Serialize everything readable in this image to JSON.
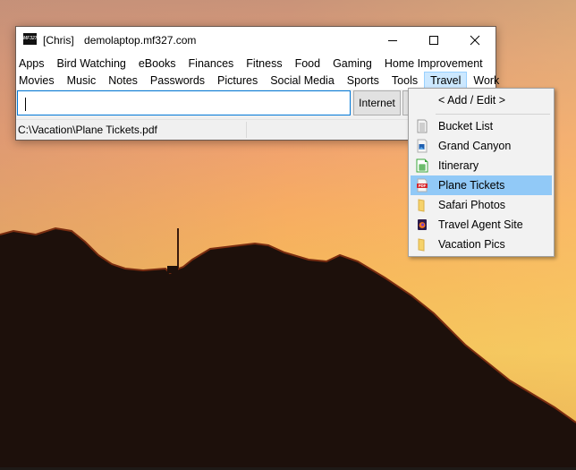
{
  "window": {
    "user": "[Chris]",
    "title": "demolaptop.mf327.com",
    "logo_text": "MF327",
    "controls": {
      "minimize": "minimize-icon",
      "maximize": "maximize-icon",
      "close": "close-icon"
    }
  },
  "menubar": {
    "row1": [
      "Apps",
      "Bird Watching",
      "eBooks",
      "Finances",
      "Fitness",
      "Food",
      "Gaming",
      "Home Improvement"
    ],
    "row2": [
      "Movies",
      "Music",
      "Notes",
      "Passwords",
      "Pictures",
      "Social Media",
      "Sports",
      "Tools",
      "Travel",
      "Work"
    ],
    "active": "Travel"
  },
  "search": {
    "value": "",
    "internet_button": "Internet"
  },
  "status": {
    "path": "C:\\Vacation\\Plane Tickets.pdf"
  },
  "dropdown": {
    "header": "< Add / Edit >",
    "items": [
      {
        "label": "Bucket List",
        "icon": "text-document-icon"
      },
      {
        "label": "Grand Canyon",
        "icon": "image-file-icon"
      },
      {
        "label": "Itinerary",
        "icon": "spreadsheet-icon"
      },
      {
        "label": "Plane Tickets",
        "icon": "pdf-icon",
        "highlighted": true
      },
      {
        "label": "Safari Photos",
        "icon": "folder-icon"
      },
      {
        "label": "Travel Agent Site",
        "icon": "firefox-icon"
      },
      {
        "label": "Vacation Pics",
        "icon": "folder-icon"
      }
    ]
  },
  "colors": {
    "highlight": "#91c9f7",
    "active_menu": "#cce8ff",
    "input_focus": "#0078d7"
  }
}
